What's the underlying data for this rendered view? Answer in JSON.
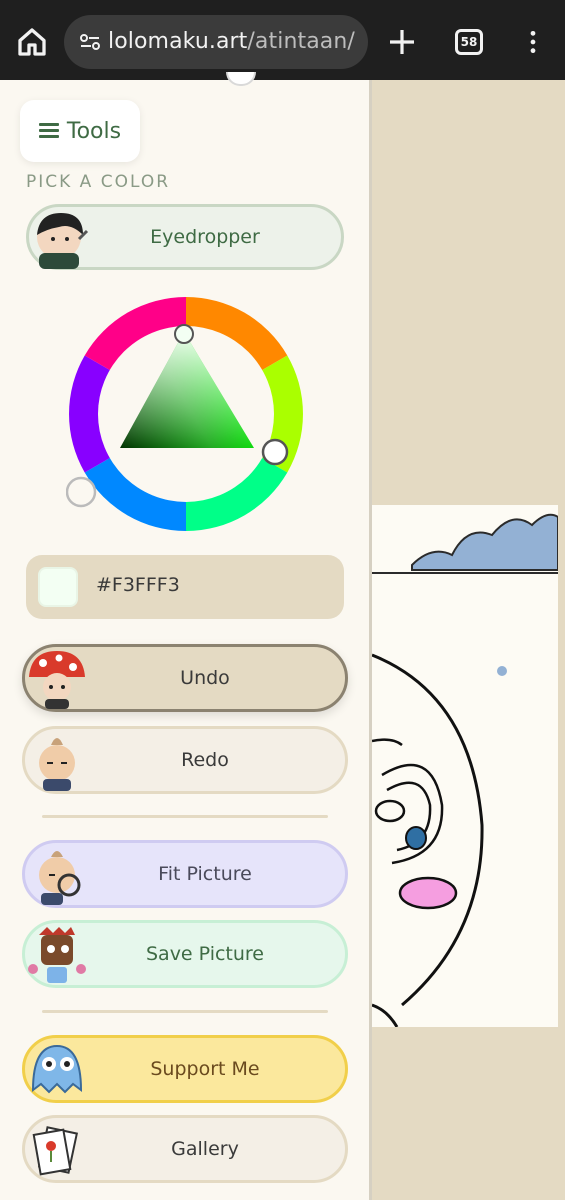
{
  "browser": {
    "url_host": "lolomaku.art",
    "url_path": "/atintaan/",
    "tab_count": "58"
  },
  "panel": {
    "tools_label": "Tools",
    "section_label": "PICK A COLOR",
    "eyedropper_label": "Eyedropper",
    "hex_value": "#F3FFF3",
    "undo_label": "Undo",
    "redo_label": "Redo",
    "fit_label": "Fit Picture",
    "save_label": "Save Picture",
    "support_label": "Support Me",
    "gallery_label": "Gallery"
  },
  "icons": [
    "home-icon",
    "site-settings-icon",
    "plus-icon",
    "tabs-icon",
    "more-vert-icon",
    "menu-icon"
  ],
  "colors": {
    "accent_green": "#3f6b44",
    "panel_bg": "#fbf8f1",
    "canvas_bg": "#e4dac3",
    "selected_color": "#F3FFF3"
  }
}
